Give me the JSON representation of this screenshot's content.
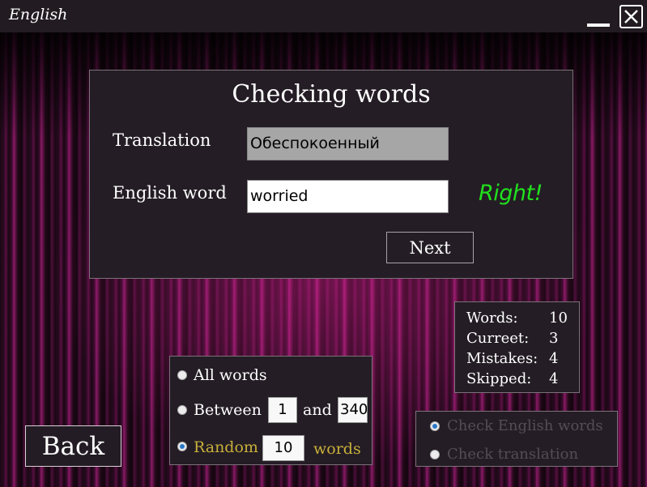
{
  "window": {
    "title": "English"
  },
  "main": {
    "title": "Checking words",
    "translation_label": "Translation",
    "translation_value": "Обеспокоенный",
    "english_label": "English word",
    "english_value": "worried",
    "result": "Right!",
    "result_color": "#21e01e",
    "next_label": "Next"
  },
  "stats": [
    {
      "label": "Words:",
      "value": "10"
    },
    {
      "label": "Curreet:",
      "value": "3"
    },
    {
      "label": "Mistakes:",
      "value": "4"
    },
    {
      "label": "Skipped:",
      "value": "4"
    }
  ],
  "range": {
    "all_label": "All words",
    "between_label": "Between",
    "between_from": "1",
    "and_label": "and",
    "between_to": "340",
    "random_label": "Random",
    "random_count": "10",
    "words_label": "words",
    "selected": "random"
  },
  "mode": {
    "check_english_label": "Check English words",
    "check_translation_label": "Check translation",
    "selected": "check_english"
  },
  "back_label": "Back",
  "icons": {
    "minimize": "minimize-icon",
    "close": "close-icon"
  }
}
